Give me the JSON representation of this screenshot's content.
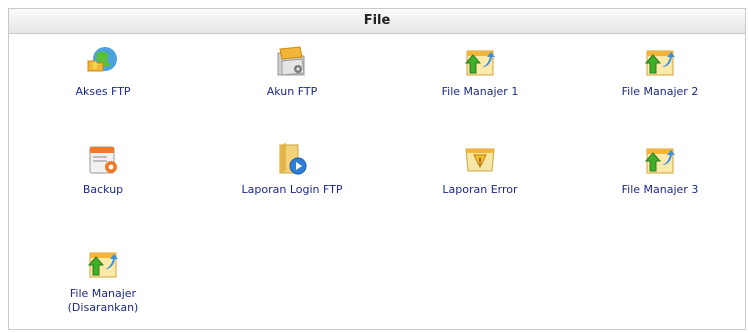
{
  "panel": {
    "title": "File"
  },
  "items": [
    {
      "label": "Akses FTP",
      "icon": "globe-folder-icon"
    },
    {
      "label": "Akun FTP",
      "icon": "folder-account-icon"
    },
    {
      "label": "File Manajer 1",
      "icon": "file-manager-icon"
    },
    {
      "label": "File Manajer 2",
      "icon": "file-manager-icon"
    },
    {
      "label": "Backup",
      "icon": "backup-icon"
    },
    {
      "label": "Laporan Login FTP",
      "icon": "login-report-icon"
    },
    {
      "label": "Laporan Error",
      "icon": "error-report-icon"
    },
    {
      "label": "File Manajer 3",
      "icon": "file-manager-icon"
    },
    {
      "label": "File Manajer\n(Disarankan)",
      "icon": "file-manager-icon"
    }
  ],
  "colors": {
    "link": "#1c2a86",
    "header_bg": "#eeeeee",
    "border": "#c9c9c9"
  }
}
